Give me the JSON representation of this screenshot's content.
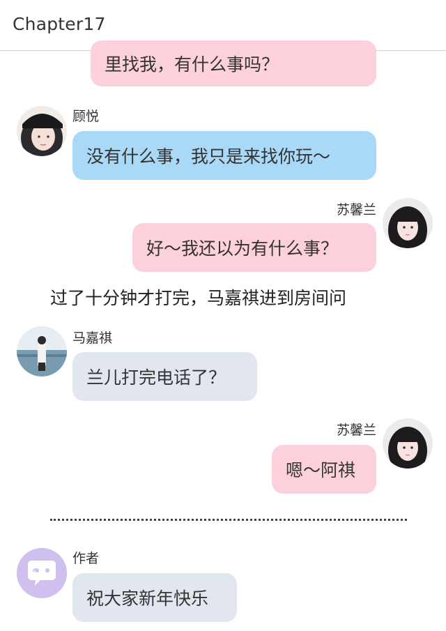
{
  "header": {
    "title": "Chapter17"
  },
  "messages": {
    "m0": {
      "text": "里找我，有什么事吗？"
    },
    "m1": {
      "name": "顾悦",
      "text": "没有什么事，我只是来找你玩～"
    },
    "m2": {
      "name": "苏馨兰",
      "text": "好～我还以为有什么事？"
    },
    "narration": {
      "text": "过了十分钟才打完，马嘉祺进到房间问"
    },
    "m3": {
      "name": "马嘉祺",
      "text": "兰儿打完电话了？"
    },
    "m4": {
      "name": "苏馨兰",
      "text": "嗯～阿祺"
    },
    "m5": {
      "name": "作者",
      "text": "祝大家新年快乐"
    }
  },
  "colors": {
    "pink_bubble": "#fcd1dc",
    "blue_bubble": "#a9d9f7",
    "gray_bubble": "#e2e7ef",
    "author_avatar": "#cfc0f0"
  }
}
